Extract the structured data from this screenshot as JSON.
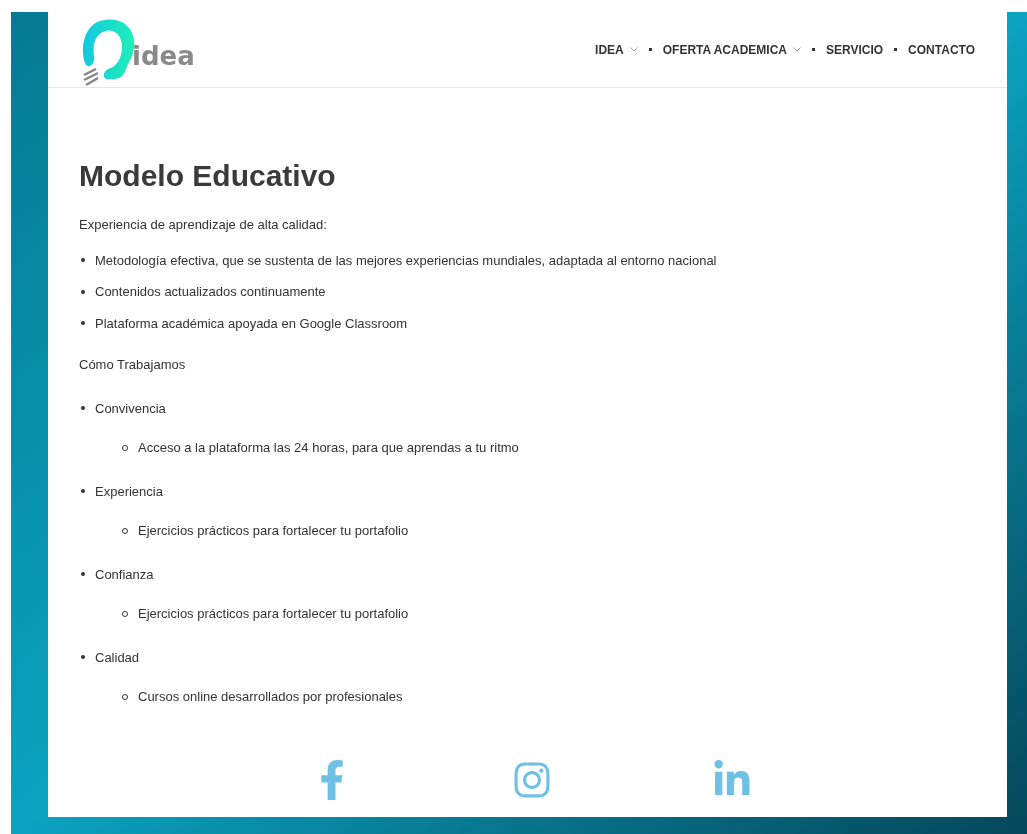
{
  "header": {
    "logo": {
      "text": "idea"
    },
    "nav": [
      {
        "label": "IDEA",
        "has_dropdown": true
      },
      {
        "label": "OFERTA ACADEMICA",
        "has_dropdown": true
      },
      {
        "label": "SERVICIO",
        "has_dropdown": false
      },
      {
        "label": "CONTACTO",
        "has_dropdown": false
      }
    ]
  },
  "content": {
    "title": "Modelo Educativo",
    "intro": "Experiencia de aprendizaje de alta calidad:",
    "features": [
      "Metodología efectiva, que se sustenta de las mejores experiencias mundiales, adaptada al entorno nacional",
      "Contenidos actualizados continuamente",
      "Plataforma académica apoyada en Google Classroom"
    ],
    "subtitle": "Cómo Trabajamos",
    "items": [
      {
        "label": "Convivencia",
        "children": [
          "Acceso a la plataforma las 24 horas, para que aprendas a tu ritmo"
        ]
      },
      {
        "label": "Experiencia",
        "children": [
          "Ejercicios prácticos para fortalecer tu portafolio"
        ]
      },
      {
        "label": "Confianza",
        "children": [
          "Ejercicios prácticos para fortalecer tu portafolio"
        ]
      },
      {
        "label": "Calidad",
        "children": [
          "Cursos online desarrollados por profesionales"
        ]
      }
    ]
  },
  "social": [
    {
      "kind": "facebook"
    },
    {
      "kind": "instagram"
    },
    {
      "kind": "linkedin"
    }
  ]
}
